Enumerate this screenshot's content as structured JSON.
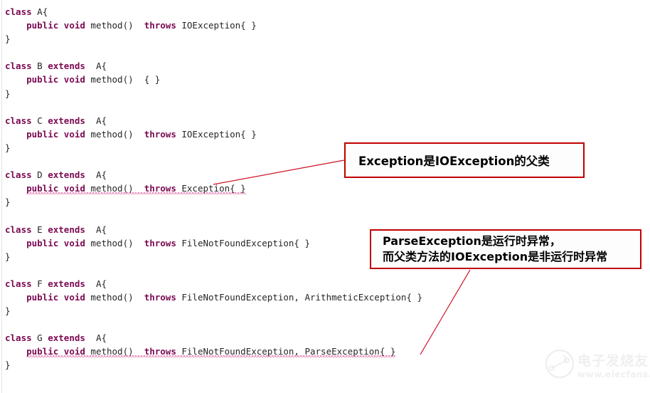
{
  "editor": {
    "background_color": "#ffffff",
    "keyword_color": "#7a0a52",
    "text_color": "#1a1a1a",
    "error_underline_color": "#e06aa8",
    "lines": [
      {
        "id": "l1",
        "indent": 0,
        "segments": [
          {
            "t": "class",
            "k": true
          },
          {
            "t": " A{",
            "k": false
          }
        ]
      },
      {
        "id": "l2",
        "indent": 1,
        "segments": [
          {
            "t": "public",
            "k": true
          },
          {
            "t": " ",
            "k": false
          },
          {
            "t": "void",
            "k": true
          },
          {
            "t": " method()  ",
            "k": false
          },
          {
            "t": "throws",
            "k": true
          },
          {
            "t": " IOException{ }",
            "k": false
          }
        ]
      },
      {
        "id": "l3",
        "indent": 0,
        "segments": [
          {
            "t": "}",
            "k": false
          }
        ]
      },
      {
        "id": "b1",
        "blank": true
      },
      {
        "id": "l4",
        "indent": 0,
        "segments": [
          {
            "t": "class",
            "k": true
          },
          {
            "t": " B ",
            "k": false
          },
          {
            "t": "extends",
            "k": true
          },
          {
            "t": "  A{",
            "k": false
          }
        ]
      },
      {
        "id": "l5",
        "indent": 1,
        "segments": [
          {
            "t": "public",
            "k": true
          },
          {
            "t": " ",
            "k": false
          },
          {
            "t": "void",
            "k": true
          },
          {
            "t": " method()  { }",
            "k": false
          }
        ]
      },
      {
        "id": "l6",
        "indent": 0,
        "segments": [
          {
            "t": "}",
            "k": false
          }
        ]
      },
      {
        "id": "b2",
        "blank": true
      },
      {
        "id": "l7",
        "indent": 0,
        "segments": [
          {
            "t": "class",
            "k": true
          },
          {
            "t": " C ",
            "k": false
          },
          {
            "t": "extends",
            "k": true
          },
          {
            "t": "  A{",
            "k": false
          }
        ]
      },
      {
        "id": "l8",
        "indent": 1,
        "segments": [
          {
            "t": "public",
            "k": true
          },
          {
            "t": " ",
            "k": false
          },
          {
            "t": "void",
            "k": true
          },
          {
            "t": " method()  ",
            "k": false
          },
          {
            "t": "throws",
            "k": true
          },
          {
            "t": " IOException{ }",
            "k": false
          }
        ]
      },
      {
        "id": "l9",
        "indent": 0,
        "segments": [
          {
            "t": "}",
            "k": false
          }
        ]
      },
      {
        "id": "b3",
        "blank": true
      },
      {
        "id": "l10",
        "indent": 0,
        "segments": [
          {
            "t": "class",
            "k": true
          },
          {
            "t": " D ",
            "k": false
          },
          {
            "t": "extends",
            "k": true
          },
          {
            "t": "  A{",
            "k": false
          }
        ]
      },
      {
        "id": "l11",
        "indent": 1,
        "error": true,
        "segments": [
          {
            "t": "public",
            "k": true
          },
          {
            "t": " ",
            "k": false
          },
          {
            "t": "void",
            "k": true
          },
          {
            "t": " method()  ",
            "k": false
          },
          {
            "t": "throws",
            "k": true
          },
          {
            "t": " Exception{ }",
            "k": false
          }
        ]
      },
      {
        "id": "l12",
        "indent": 0,
        "segments": [
          {
            "t": "}",
            "k": false
          }
        ]
      },
      {
        "id": "b4",
        "blank": true
      },
      {
        "id": "l13",
        "indent": 0,
        "segments": [
          {
            "t": "class",
            "k": true
          },
          {
            "t": " E ",
            "k": false
          },
          {
            "t": "extends",
            "k": true
          },
          {
            "t": "  A{",
            "k": false
          }
        ]
      },
      {
        "id": "l14",
        "indent": 1,
        "segments": [
          {
            "t": "public",
            "k": true
          },
          {
            "t": " ",
            "k": false
          },
          {
            "t": "void",
            "k": true
          },
          {
            "t": " method()  ",
            "k": false
          },
          {
            "t": "throws",
            "k": true
          },
          {
            "t": " FileNotFoundException{ }",
            "k": false
          }
        ]
      },
      {
        "id": "l15",
        "indent": 0,
        "segments": [
          {
            "t": "}",
            "k": false
          }
        ]
      },
      {
        "id": "b5",
        "blank": true
      },
      {
        "id": "l16",
        "indent": 0,
        "segments": [
          {
            "t": "class",
            "k": true
          },
          {
            "t": " F ",
            "k": false
          },
          {
            "t": "extends",
            "k": true
          },
          {
            "t": "  A{",
            "k": false
          }
        ]
      },
      {
        "id": "l17",
        "indent": 1,
        "segments": [
          {
            "t": "public",
            "k": true
          },
          {
            "t": " ",
            "k": false
          },
          {
            "t": "void",
            "k": true
          },
          {
            "t": " method()  ",
            "k": false
          },
          {
            "t": "throws",
            "k": true
          },
          {
            "t": " FileNotFoundException, ArithmeticException{ }",
            "k": false
          }
        ]
      },
      {
        "id": "l18",
        "indent": 0,
        "segments": [
          {
            "t": "}",
            "k": false
          }
        ]
      },
      {
        "id": "b6",
        "blank": true
      },
      {
        "id": "l19",
        "indent": 0,
        "segments": [
          {
            "t": "class",
            "k": true
          },
          {
            "t": " G ",
            "k": false
          },
          {
            "t": "extends",
            "k": true
          },
          {
            "t": "  A{",
            "k": false
          }
        ]
      },
      {
        "id": "l20",
        "indent": 1,
        "error": true,
        "segments": [
          {
            "t": "public",
            "k": true
          },
          {
            "t": " ",
            "k": false
          },
          {
            "t": "void",
            "k": true
          },
          {
            "t": " method()  ",
            "k": false
          },
          {
            "t": "throws",
            "k": true
          },
          {
            "t": " FileNotFoundException, ParseException{ }",
            "k": false
          }
        ]
      },
      {
        "id": "l21",
        "indent": 0,
        "segments": [
          {
            "t": "}",
            "k": false
          }
        ]
      }
    ]
  },
  "annotations": {
    "border_color": "#c00000",
    "callout_1": {
      "text": "Exception是IOException的父类"
    },
    "callout_2": {
      "line_1": "ParseException是运行时异常，",
      "line_2": "而父类方法的IOException是非运行时异常"
    }
  },
  "watermark": {
    "name": "电子发烧友",
    "url": "www.elecfans.com",
    "color": "#9aa0a6"
  }
}
